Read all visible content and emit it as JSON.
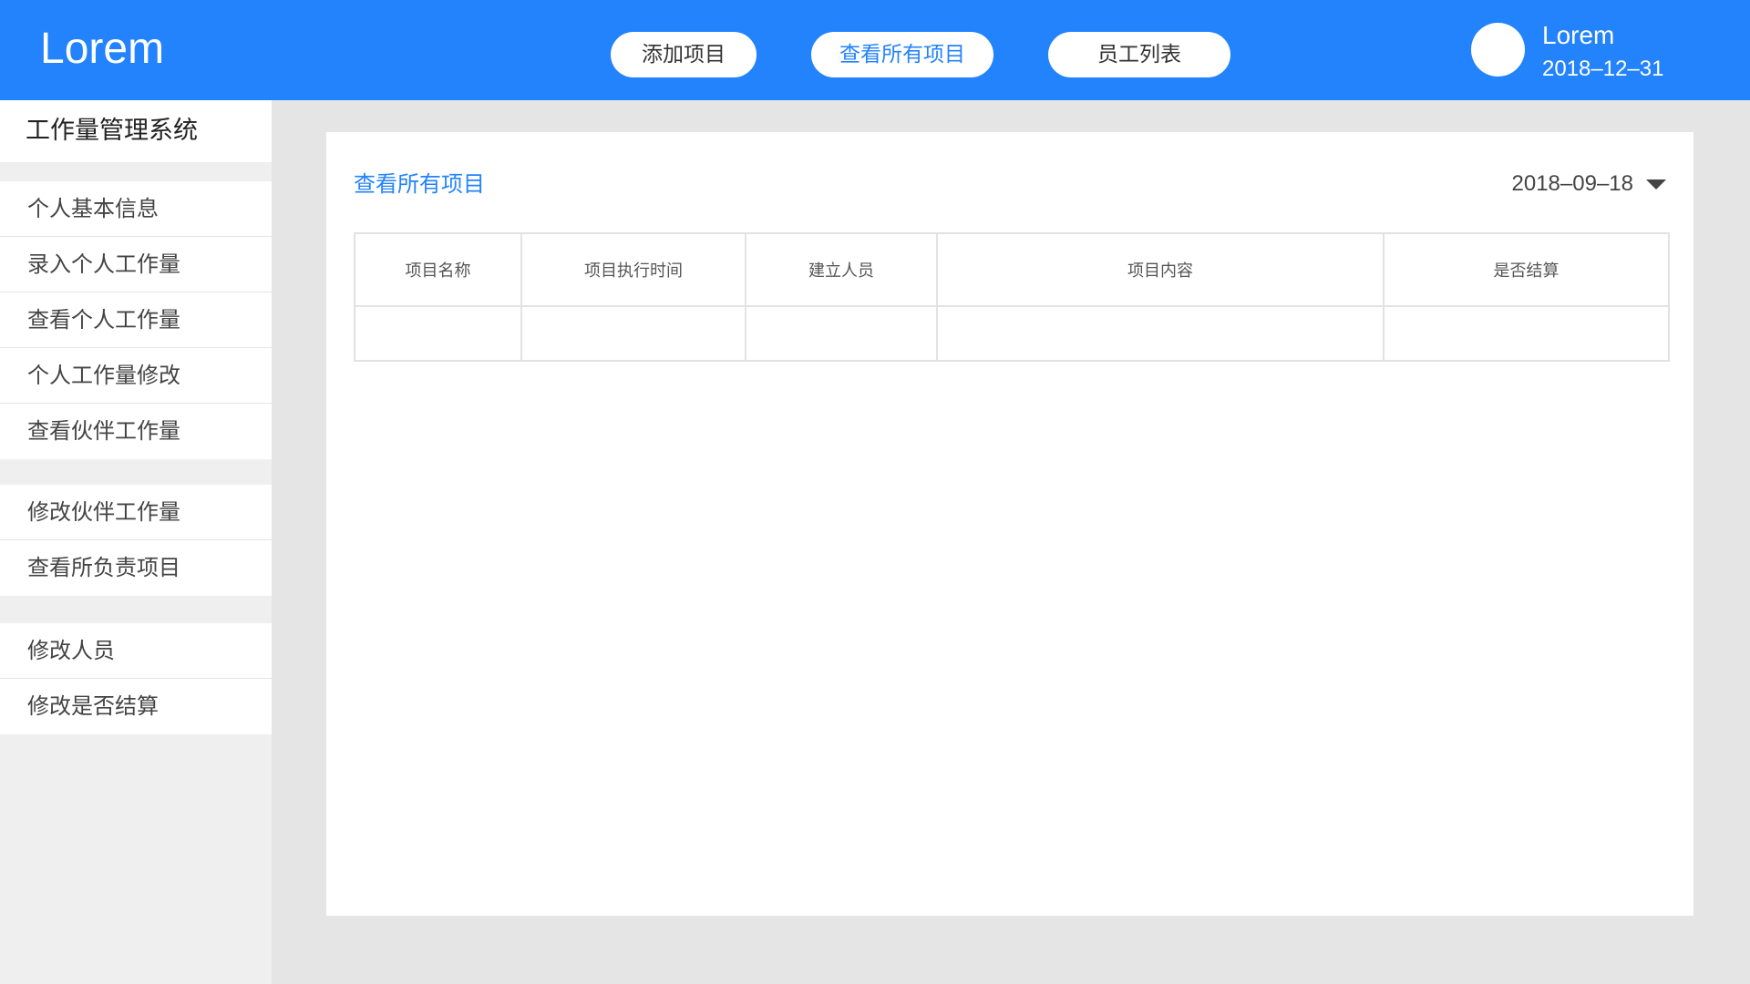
{
  "header": {
    "logo": "Lorem",
    "nav": {
      "add_project": "添加项目",
      "view_all_projects": "查看所有项目",
      "staff_list": "员工列表"
    },
    "user": {
      "name": "Lorem",
      "date": "2018–12–31"
    }
  },
  "sidebar": {
    "title": "工作量管理系统",
    "groups": [
      {
        "items": [
          {
            "label": "个人基本信息"
          },
          {
            "label": "录入个人工作量"
          },
          {
            "label": "查看个人工作量"
          },
          {
            "label": "个人工作量修改"
          },
          {
            "label": "查看伙伴工作量"
          }
        ]
      },
      {
        "items": [
          {
            "label": "修改伙伴工作量"
          },
          {
            "label": "查看所负责项目"
          }
        ]
      },
      {
        "items": [
          {
            "label": "修改人员"
          },
          {
            "label": "修改是否结算"
          }
        ]
      }
    ]
  },
  "main": {
    "title": "查看所有项目",
    "date_filter": "2018–09–18",
    "table": {
      "columns": [
        "项目名称",
        "项目执行时间",
        "建立人员",
        "项目内容",
        "是否结算"
      ]
    }
  },
  "colors": {
    "primary": "#2383fc",
    "background": "#e5e5e5",
    "sidebar_bg": "#efefef"
  },
  "icons": {
    "date_dropdown": "caret-down-icon"
  }
}
